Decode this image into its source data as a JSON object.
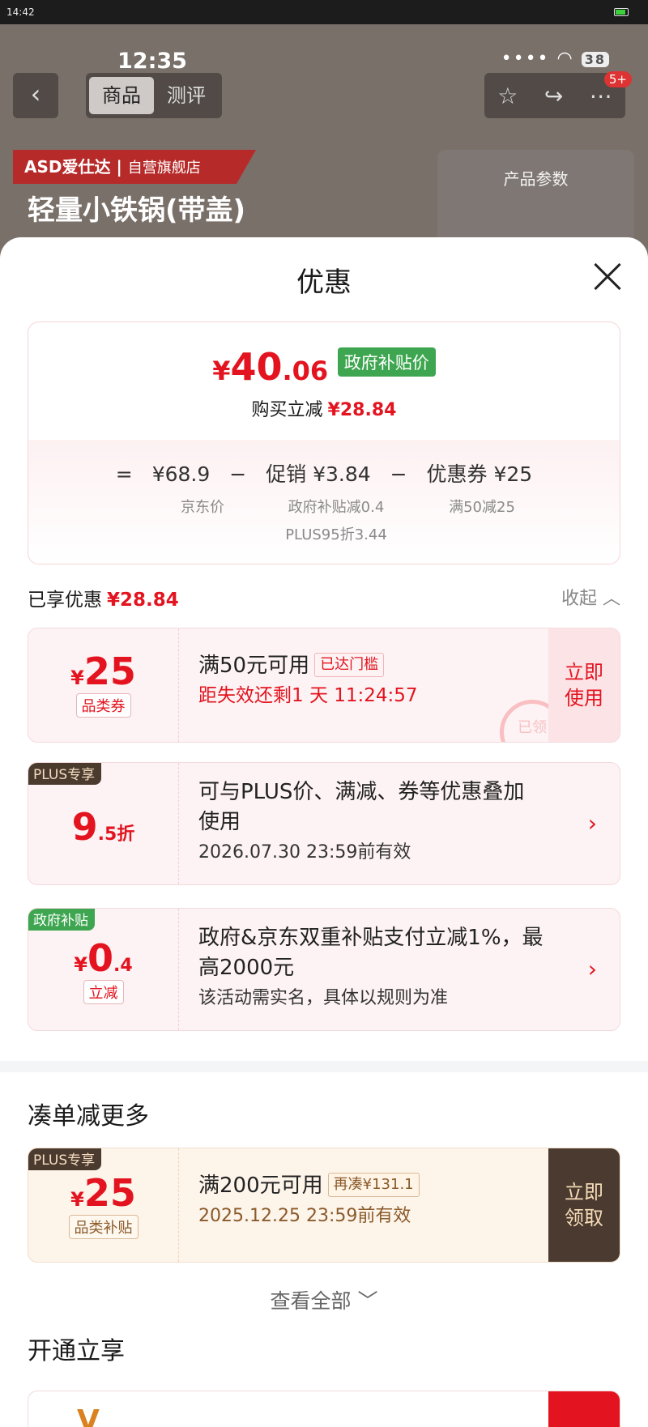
{
  "system": {
    "clock": "14:42"
  },
  "behind": {
    "time": "12:35",
    "signal": "••••",
    "battery": "38",
    "tabs": [
      "商品",
      "测评"
    ],
    "badge": "5+",
    "brand": "ASD爱仕达",
    "store": "自营旗舰店",
    "product_title": "轻量小铁锅(带盖)",
    "params_label": "产品参数"
  },
  "sheet": {
    "title": "优惠",
    "final_price": {
      "symbol": "¥",
      "integer": "40",
      "decimal": ".06"
    },
    "gov_price_tag": "政府补贴价",
    "reduce_label": "购买立减",
    "reduce_value": "¥28.84",
    "formula": {
      "eq": "=",
      "jd_price": "¥68.9",
      "minus1": "−",
      "promo": "促销 ¥3.84",
      "minus2": "−",
      "coupon": "优惠券 ¥25"
    },
    "formula_sub": {
      "jd_label": "京东价",
      "gov_sub": "政府补贴减0.4",
      "plus_sub": "PLUS95折3.44",
      "coupon_sub": "满50减25"
    },
    "enjoyed_label": "已享优惠",
    "enjoyed_value": "¥28.84",
    "collapse_label": "收起"
  },
  "coupons": [
    {
      "symbol": "¥",
      "amount": "25",
      "tag": "品类券",
      "main": "满50元可用",
      "reach": "已达门槛",
      "sub": "距失效还剩1 天 11:24:57",
      "action": [
        "立即",
        "使用"
      ],
      "stamp": "已领"
    },
    {
      "corner": "PLUS专享",
      "amount": "9",
      "amount_small": ".5折",
      "main_line1": "可与PLUS价、满减、券等优惠叠加",
      "main_line2": "使用",
      "sub": "2026.07.30 23:59前有效"
    },
    {
      "corner": "政府补贴",
      "symbol": "¥",
      "amount": "0",
      "amount_small": ".4",
      "tag": "立减",
      "main_line1": "政府&京东双重补贴支付立减1%，最",
      "main_line2": "高2000元",
      "sub": "该活动需实名，具体以规则为准"
    }
  ],
  "more": {
    "title": "凑单减更多",
    "coupon": {
      "corner": "PLUS专享",
      "symbol": "¥",
      "amount": "25",
      "tag": "品类补贴",
      "main": "满200元可用",
      "reach": "再凑¥131.1",
      "sub": "2025.12.25 23:59前有效",
      "action": [
        "立即",
        "领取"
      ]
    },
    "see_all": "查看全部"
  },
  "open": {
    "title": "开通立享"
  }
}
